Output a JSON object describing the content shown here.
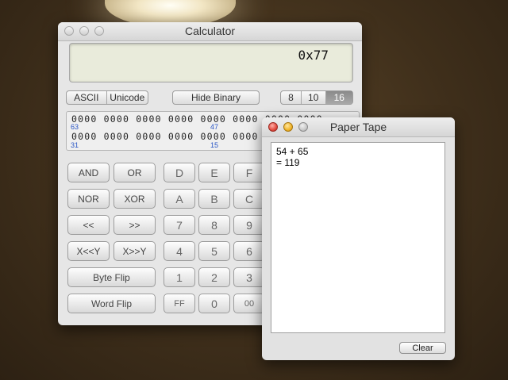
{
  "calculator": {
    "title": "Calculator",
    "display_value": "0x77",
    "char_mode": [
      "ASCII",
      "Unicode"
    ],
    "hide_binary_label": "Hide Binary",
    "bases": [
      {
        "label": "8",
        "selected": false
      },
      {
        "label": "10",
        "selected": false
      },
      {
        "label": "16",
        "selected": true
      }
    ],
    "binary": {
      "row1": "0000 0000 0000 0000 0000 0000 0000 0000",
      "row2": "0000 0000 0000 0000 0000 0000 0000 0000",
      "idx_63": "63",
      "idx_47": "47",
      "idx_31": "31",
      "idx_15": "15"
    },
    "ops": {
      "and": "AND",
      "or": "OR",
      "nor": "NOR",
      "xor": "XOR",
      "shl": "<<",
      "shr": ">>",
      "xshl": "X<<Y",
      "xshr": "X>>Y",
      "byte_flip": "Byte Flip",
      "word_flip": "Word Flip"
    },
    "keys": {
      "d": "D",
      "e": "E",
      "f": "F",
      "a": "A",
      "b": "B",
      "c": "C",
      "k7": "7",
      "k8": "8",
      "k9": "9",
      "k4": "4",
      "k5": "5",
      "k6": "6",
      "k1": "1",
      "k2": "2",
      "k3": "3",
      "ff": "FF",
      "k0": "0",
      "k00": "00"
    }
  },
  "paper_tape": {
    "title": "Paper Tape",
    "lines": [
      "54 + 65",
      "= 119"
    ],
    "clear_label": "Clear"
  },
  "colors": {
    "selected_base_bg": "#9a9a9a",
    "bit_index_color": "#2a56c6",
    "lcd_bg": "#e9ebdb"
  }
}
